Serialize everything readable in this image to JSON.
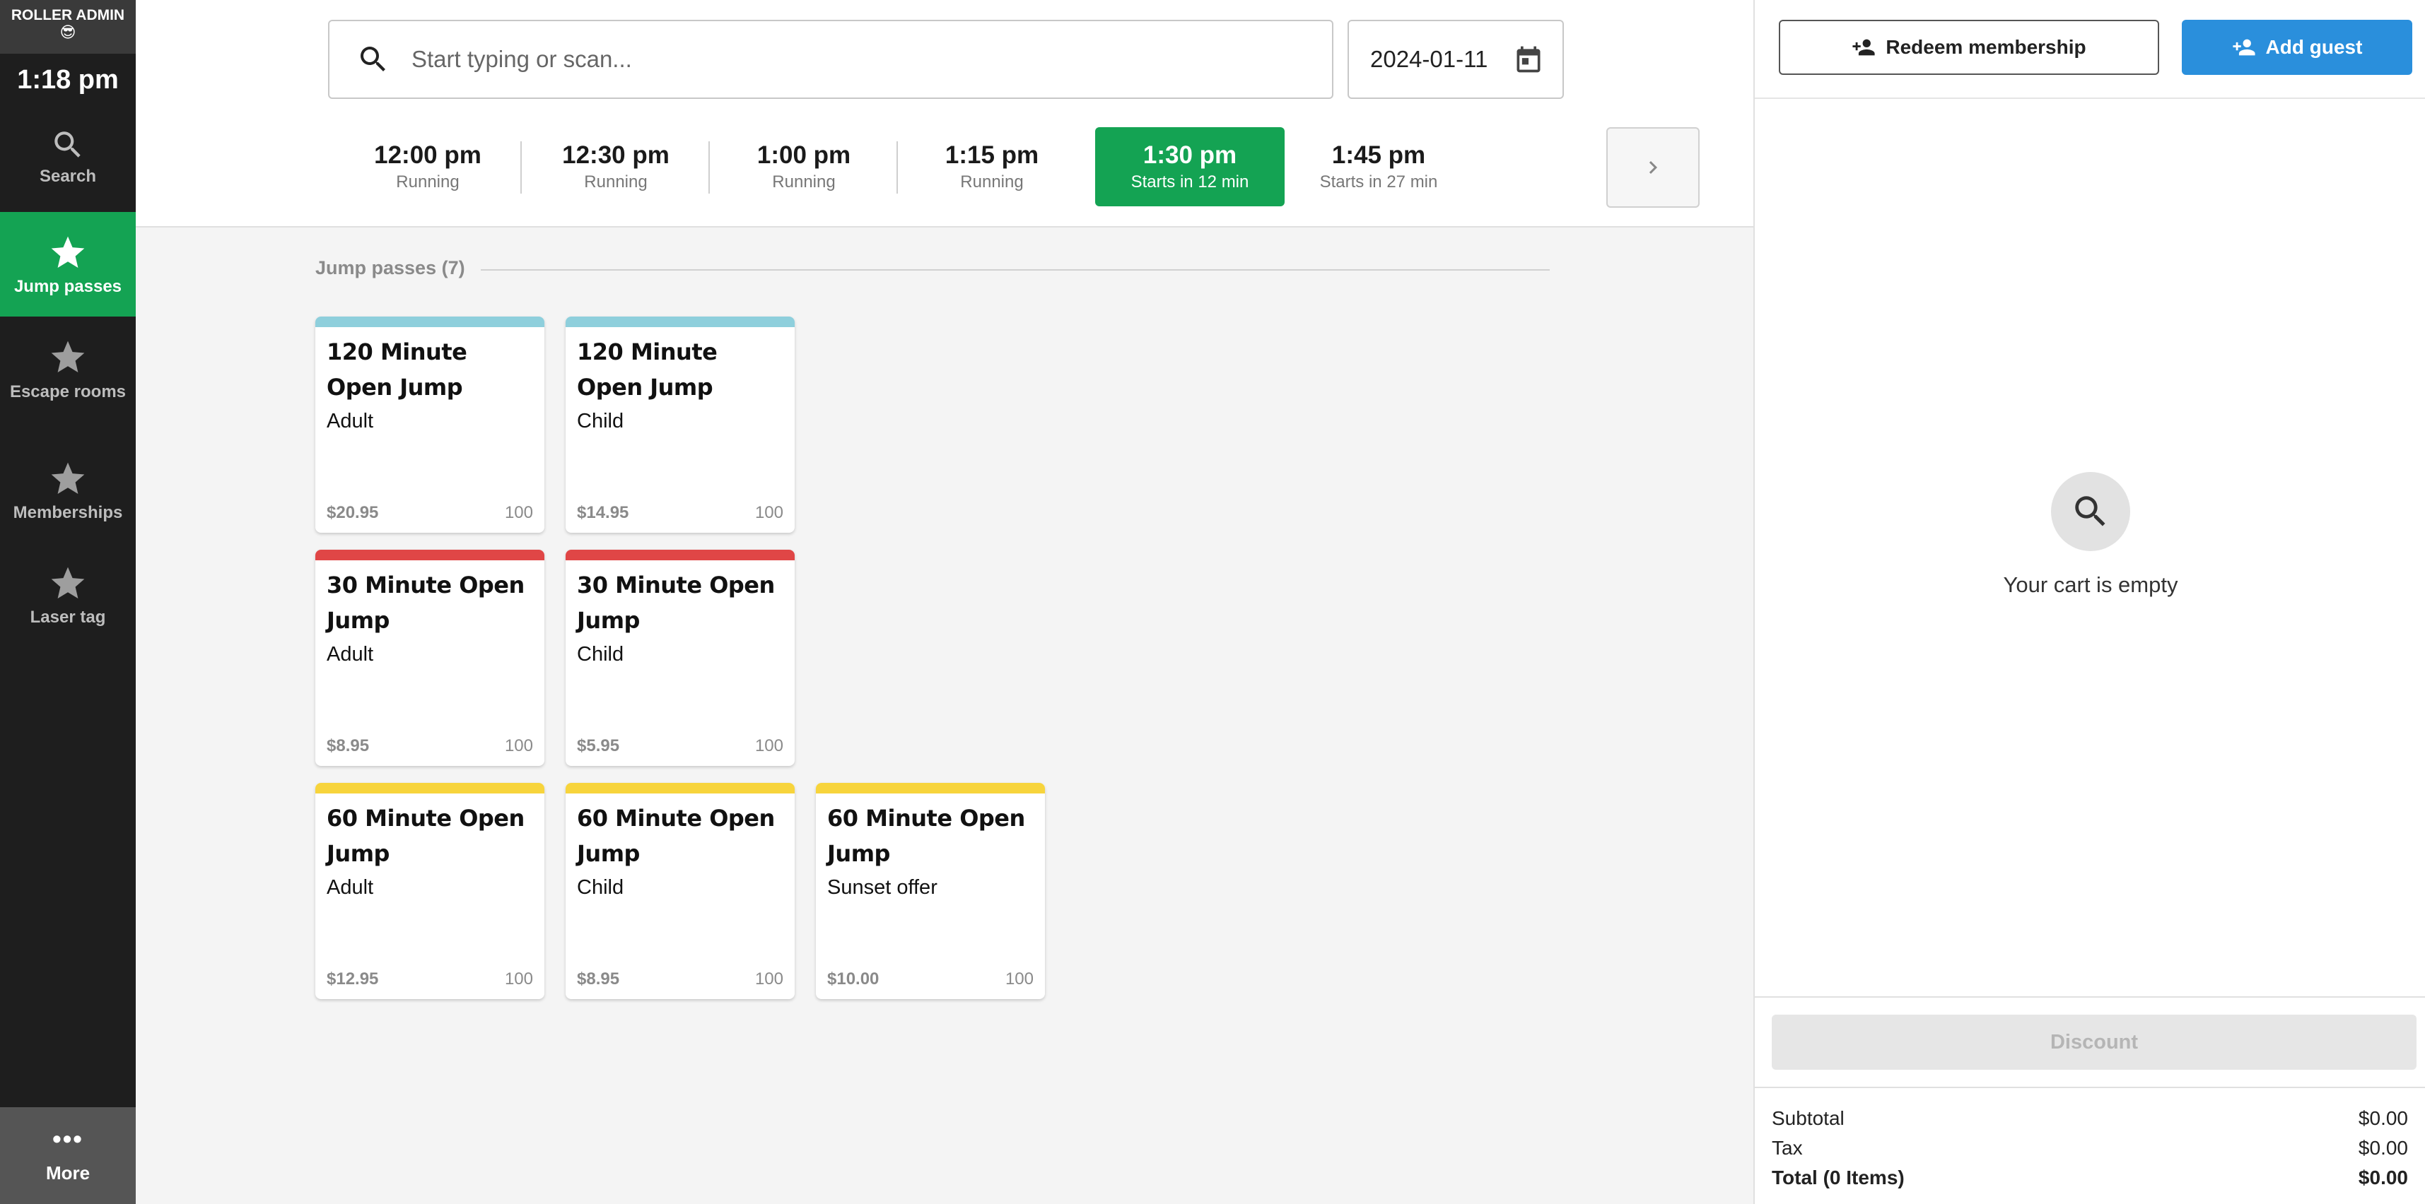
{
  "sidebar": {
    "brand": "ROLLER ADMIN",
    "brand_emoji": "😎",
    "clock": "1:18 pm",
    "items": [
      {
        "label": "Search",
        "icon": "search-icon"
      },
      {
        "label": "Jump passes",
        "icon": "star-icon",
        "active": true
      },
      {
        "label": "Escape rooms",
        "icon": "star-icon"
      },
      {
        "label": "Memberships",
        "icon": "star-icon"
      },
      {
        "label": "Laser tag",
        "icon": "star-icon"
      }
    ],
    "more": {
      "dots": "•••",
      "label": "More"
    }
  },
  "search": {
    "placeholder": "Start typing or scan..."
  },
  "date": {
    "value": "2024-01-11"
  },
  "time_slots": [
    {
      "time": "12:00 pm",
      "status": "Running"
    },
    {
      "time": "12:30 pm",
      "status": "Running"
    },
    {
      "time": "1:00 pm",
      "status": "Running"
    },
    {
      "time": "1:15 pm",
      "status": "Running"
    },
    {
      "time": "1:30 pm",
      "status": "Starts in 12 min",
      "active": true
    },
    {
      "time": "1:45 pm",
      "status": "Starts in 27 min"
    }
  ],
  "section": {
    "title": "Jump passes (7)"
  },
  "colors": {
    "blue": "#8ecfdc",
    "red": "#e04646",
    "yellow": "#f7d43c",
    "green": "#14a353",
    "accent": "#2a8fdc"
  },
  "products": [
    {
      "name": "120 Minute Open Jump",
      "variant": "Adult",
      "price": "$20.95",
      "qty": "100",
      "color": "#8ecfdc"
    },
    {
      "name": "120 Minute Open Jump",
      "variant": "Child",
      "price": "$14.95",
      "qty": "100",
      "color": "#8ecfdc"
    },
    {
      "name": "30 Minute Open Jump",
      "variant": "Adult",
      "price": "$8.95",
      "qty": "100",
      "color": "#e04646"
    },
    {
      "name": "30 Minute Open Jump",
      "variant": "Child",
      "price": "$5.95",
      "qty": "100",
      "color": "#e04646"
    },
    {
      "name": "60 Minute Open Jump",
      "variant": "Adult",
      "price": "$12.95",
      "qty": "100",
      "color": "#f7d43c"
    },
    {
      "name": "60 Minute Open Jump",
      "variant": "Child",
      "price": "$8.95",
      "qty": "100",
      "color": "#f7d43c"
    },
    {
      "name": "60 Minute Open Jump",
      "variant": "Sunset offer",
      "price": "$10.00",
      "qty": "100",
      "color": "#f7d43c"
    }
  ],
  "cart": {
    "redeem_label": "Redeem membership",
    "add_guest_label": "Add guest",
    "empty_message": "Your cart is empty",
    "discount_label": "Discount",
    "subtotal_label": "Subtotal",
    "subtotal_value": "$0.00",
    "tax_label": "Tax",
    "tax_value": "$0.00",
    "total_label": "Total (0 Items)",
    "total_value": "$0.00"
  }
}
